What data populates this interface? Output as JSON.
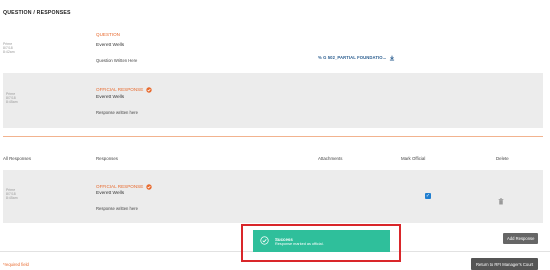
{
  "header": {
    "title": "QUESTION / RESPONSES"
  },
  "question": {
    "meta": [
      "Prime",
      "8/7/18",
      "8:42am"
    ],
    "label": "QUESTION",
    "author": "Everett Wells",
    "text": "Question Written Here",
    "attachment": "% G 502_PARTIAL FOUNDATIO..."
  },
  "official_response": {
    "meta": [
      "Prime",
      "8/7/18",
      "8:45am"
    ],
    "label": "OFFICIAL RESPONSE",
    "author": "Everett Wells",
    "text": "Response written here"
  },
  "table": {
    "headers": {
      "all": "All Responses",
      "responses": "Responses",
      "attachments": "Attachments",
      "mark_official": "Mark Official",
      "delete": "Delete"
    },
    "rows": [
      {
        "meta": [
          "Prime",
          "8/7/18",
          "8:45am"
        ],
        "label": "OFFICIAL RESPONSE",
        "author": "Everett Wells",
        "text": "Response written here",
        "official": true
      }
    ]
  },
  "buttons": {
    "add_response": "Add Response",
    "return": "Return to RFI Manager's Court"
  },
  "toast": {
    "title": "Success",
    "message": "Response marked as official."
  },
  "footer": {
    "required": "*required field"
  },
  "colors": {
    "accent": "#e86a2e",
    "toast": "#2fbf9b",
    "highlight": "#d9262a",
    "checkbox": "#1f7ed0"
  }
}
